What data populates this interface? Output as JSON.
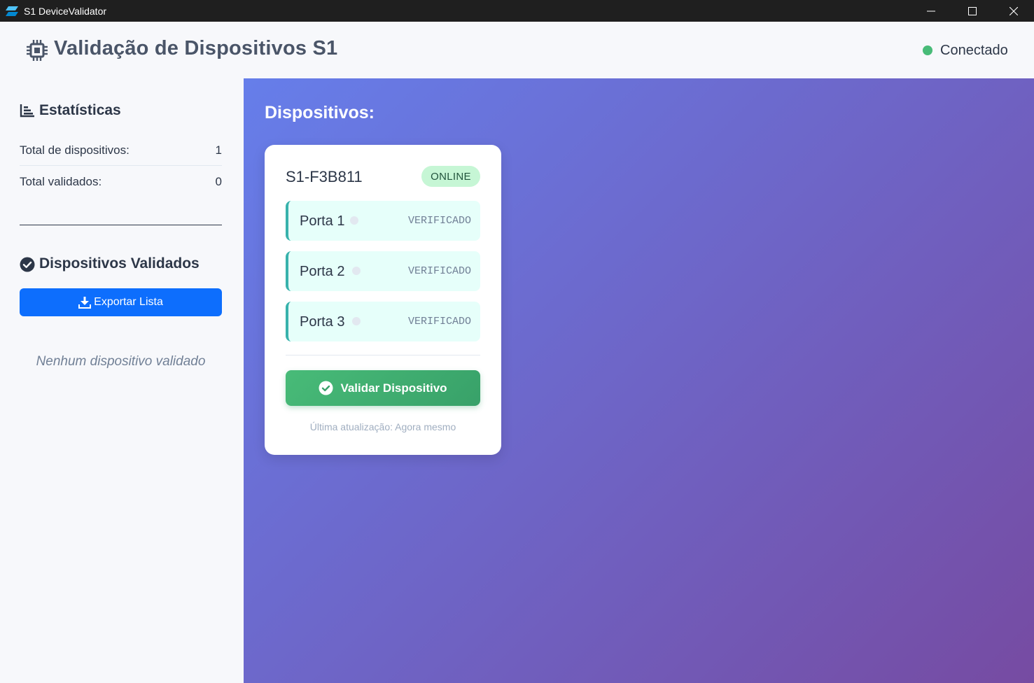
{
  "window": {
    "title": "S1 DeviceValidator",
    "icons": {
      "app": "app-logo-icon",
      "minimize": "minimize-icon",
      "maximize": "maximize-icon",
      "close": "close-icon"
    }
  },
  "header": {
    "title": "Validação de Dispositivos S1",
    "icon": "chip-icon",
    "connection_status": "Conectado",
    "connection_color": "#48bb78"
  },
  "sidebar": {
    "stats": {
      "title": "Estatísticas",
      "icon": "bar-chart-icon",
      "rows": [
        {
          "label": "Total de dispositivos:",
          "value": "1"
        },
        {
          "label": "Total validados:",
          "value": "0"
        }
      ]
    },
    "validated": {
      "title": "Dispositivos Validados",
      "icon": "check-circle-icon",
      "export_label": "Exportar Lista",
      "export_icon": "download-icon",
      "empty_text": "Nenhum dispositivo validado"
    }
  },
  "main": {
    "title": "Dispositivos:",
    "device": {
      "name": "S1-F3B811",
      "status": "ONLINE",
      "ports": [
        {
          "label": "Porta 1",
          "status": "VERIFICADO"
        },
        {
          "label": "Porta 2",
          "status": "VERIFICADO"
        },
        {
          "label": "Porta 3",
          "status": "VERIFICADO"
        }
      ],
      "validate_label": "Validar Dispositivo",
      "validate_icon": "check-circle-icon",
      "last_update": "Última atualização: Agora mesmo"
    }
  },
  "colors": {
    "primary_blue": "#0d6efd",
    "success_green": "#48bb78",
    "gradient_start": "#667eea",
    "gradient_end": "#764ba2",
    "port_background": "#e6fffa",
    "port_accent": "#38b2ac"
  }
}
